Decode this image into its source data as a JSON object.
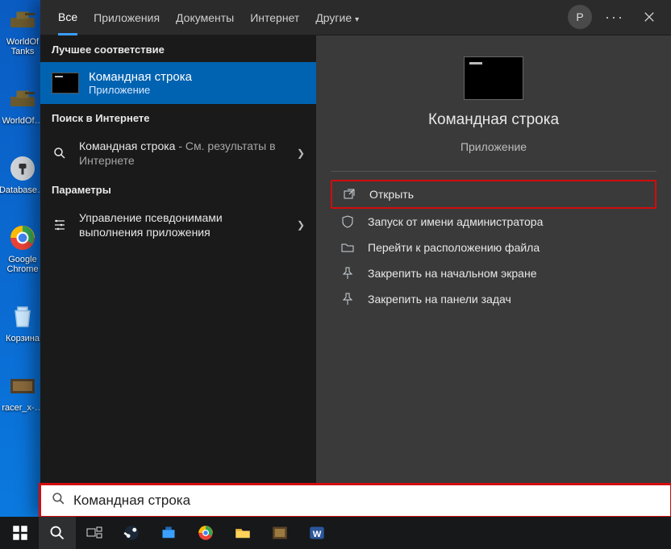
{
  "avatar_letter": "P",
  "tabs": {
    "all": "Все",
    "apps": "Приложения",
    "docs": "Документы",
    "internet": "Интернет",
    "other": "Другие"
  },
  "left": {
    "best_match_header": "Лучшее соответствие",
    "best_match": {
      "title": "Командная строка",
      "subtitle": "Приложение"
    },
    "web_header": "Поиск в Интернете",
    "web_item": {
      "title": "Командная строка",
      "suffix": " - См. результаты в Интернете"
    },
    "params_header": "Параметры",
    "params_item": "Управление псевдонимами выполнения приложения"
  },
  "right": {
    "title": "Командная строка",
    "subtitle": "Приложение",
    "actions": {
      "open": "Открыть",
      "admin": "Запуск от имени администратора",
      "goto": "Перейти к расположению файла",
      "pin_start": "Закрепить на начальном экране",
      "pin_tb": "Закрепить на панели задач"
    }
  },
  "search_value": "Командная строка",
  "desktop": {
    "i1": "WorldOf Tanks",
    "i2": "WorldOf…",
    "i3": "Database…",
    "i4": "Google Chrome",
    "i5": "Корзина",
    "i6": "racer_x-…"
  }
}
